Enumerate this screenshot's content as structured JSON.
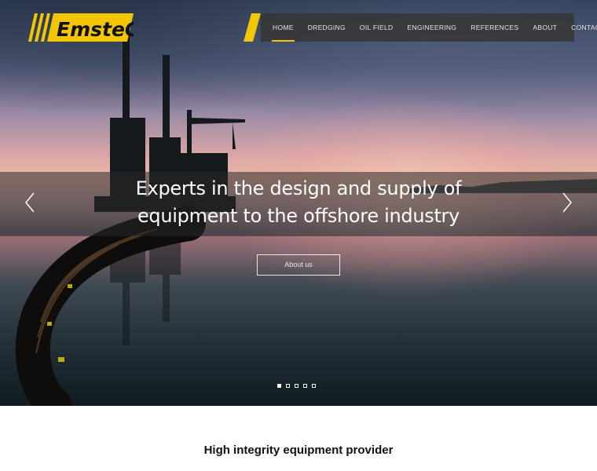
{
  "brand": {
    "logo_text": "EmsteC",
    "accent_color": "#f2c600"
  },
  "nav": {
    "items": [
      {
        "label": "HOME",
        "active": true
      },
      {
        "label": "DREDGING"
      },
      {
        "label": "OIL FIELD"
      },
      {
        "label": "ENGINEERING"
      },
      {
        "label": "REFERENCES"
      },
      {
        "label": "ABOUT"
      },
      {
        "label": "CONTACT"
      }
    ]
  },
  "hero": {
    "headline_line1": "Experts in the design and supply of",
    "headline_line2": "equipment to the offshore industry",
    "cta_label": "About us",
    "prev_icon": "chevron-left-icon",
    "next_icon": "chevron-right-icon",
    "slide_count": 5,
    "active_slide": 1
  },
  "section": {
    "tagline": "High integrity equipment provider"
  }
}
